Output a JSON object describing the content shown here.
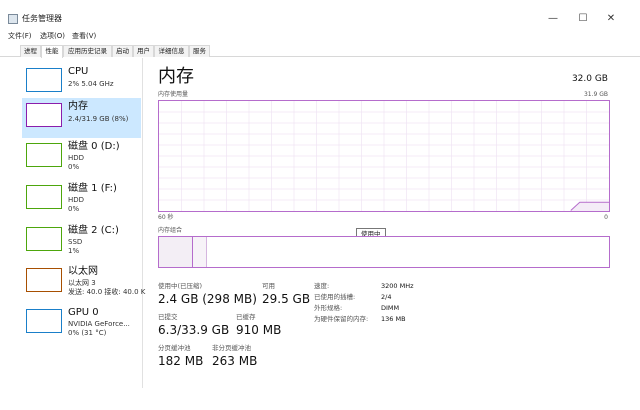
{
  "window": {
    "title": "任务管理器",
    "min": "—",
    "max": "☐",
    "close": "✕"
  },
  "menu": [
    "文件(F)",
    "选项(O)",
    "查看(V)"
  ],
  "tabs": [
    "进程",
    "性能",
    "应用历史记录",
    "启动",
    "用户",
    "详细信息",
    "服务"
  ],
  "sidebar": {
    "items": [
      {
        "name": "CPU",
        "lines": [
          "2% 5.04 GHz"
        ],
        "color": "#1a7fc9"
      },
      {
        "name": "内存",
        "lines": [
          "2.4/31.9 GB (8%)"
        ],
        "color": "#8b1dab"
      },
      {
        "name": "磁盘 0 (D:)",
        "lines": [
          "HDD",
          "0%"
        ],
        "color": "#4da60c"
      },
      {
        "name": "磁盘 1 (F:)",
        "lines": [
          "HDD",
          "0%"
        ],
        "color": "#4da60c"
      },
      {
        "name": "磁盘 2 (C:)",
        "lines": [
          "SSD",
          "1%"
        ],
        "color": "#4da60c"
      },
      {
        "name": "以太网",
        "lines": [
          "以太网 3",
          "发送: 40.0 接收: 40.0 K"
        ],
        "color": "#a74f01"
      },
      {
        "name": "GPU 0",
        "lines": [
          "NVIDIA GeForce...",
          "0% (31 °C)"
        ],
        "color": "#1a7fc9"
      }
    ]
  },
  "main": {
    "title": "内存",
    "total": "32.0 GB",
    "usage_label": "内存使用量",
    "usage_max": "31.9 GB",
    "axis_left": "60 秒",
    "axis_right": "0",
    "composition_label": "内存组合",
    "tooltip": "使用中",
    "graph_color": "#b56ccc",
    "usage_fraction": 0.08
  },
  "stats": {
    "in_use_label": "使用中(已压缩)",
    "in_use_value": "2.4 GB (298 MB)",
    "available_label": "可用",
    "available_value": "29.5 GB",
    "committed_label": "已提交",
    "committed_value": "6.3/33.9 GB",
    "cached_label": "已缓存",
    "cached_value": "910 MB",
    "paged_label": "分页缓冲池",
    "paged_value": "182 MB",
    "nonpaged_label": "非分页缓冲池",
    "nonpaged_value": "263 MB"
  },
  "specs": [
    {
      "label": "速度:",
      "value": "3200 MHz"
    },
    {
      "label": "已使用的插槽:",
      "value": "2/4"
    },
    {
      "label": "外形规格:",
      "value": "DIMM"
    },
    {
      "label": "为硬件保留的内存:",
      "value": "136 MB"
    }
  ]
}
